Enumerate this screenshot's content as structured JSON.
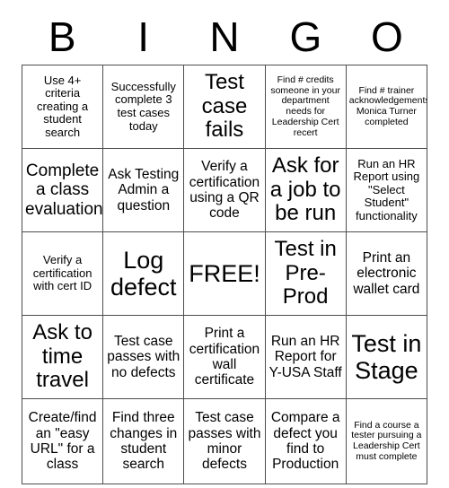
{
  "header": {
    "letters": [
      "B",
      "I",
      "N",
      "G",
      "O"
    ]
  },
  "grid": {
    "rows": 5,
    "cols": 5,
    "border_color": "#4d4d4d",
    "background_color": "#ffffff",
    "text_color": "#000000",
    "cells": [
      [
        {
          "text": "Use 4+ criteria creating a student search",
          "size": "sz-s"
        },
        {
          "text": "Successfully complete 3 test cases today",
          "size": "sz-s"
        },
        {
          "text": "Test case fails",
          "size": "sz-xl"
        },
        {
          "text": "Find # credits someone in your department needs for Leadership Cert recert",
          "size": "sz-xs"
        },
        {
          "text": "Find # trainer acknowledgements Monica Turner completed",
          "size": "sz-xs"
        }
      ],
      [
        {
          "text": "Complete a class evaluation",
          "size": "sz-l"
        },
        {
          "text": "Ask Testing Admin a question",
          "size": "sz-m"
        },
        {
          "text": "Verify a certification using a QR code",
          "size": "sz-m"
        },
        {
          "text": "Ask for a job to be run",
          "size": "sz-xl"
        },
        {
          "text": "Run an HR Report using \"Select Student\" functionality",
          "size": "sz-s"
        }
      ],
      [
        {
          "text": "Verify a certification with cert ID",
          "size": "sz-s"
        },
        {
          "text": "Log defect",
          "size": "sz-xxl"
        },
        {
          "text": "FREE!",
          "size": "sz-xxl"
        },
        {
          "text": "Test in Pre-Prod",
          "size": "sz-xl"
        },
        {
          "text": "Print an electronic wallet card",
          "size": "sz-m"
        }
      ],
      [
        {
          "text": "Ask to time travel",
          "size": "sz-xl"
        },
        {
          "text": "Test case passes with no defects",
          "size": "sz-m"
        },
        {
          "text": "Print a certification wall certificate",
          "size": "sz-m"
        },
        {
          "text": "Run an HR Report for Y-USA Staff",
          "size": "sz-m"
        },
        {
          "text": "Test in Stage",
          "size": "sz-xxl"
        }
      ],
      [
        {
          "text": "Create/find an \"easy URL\" for a class",
          "size": "sz-m"
        },
        {
          "text": "Find three changes in student search",
          "size": "sz-m"
        },
        {
          "text": "Test case passes with minor defects",
          "size": "sz-m"
        },
        {
          "text": "Compare a defect you find to Production",
          "size": "sz-m"
        },
        {
          "text": "Find a course a tester pursuing a Leadership Cert must complete",
          "size": "sz-xs"
        }
      ]
    ]
  }
}
